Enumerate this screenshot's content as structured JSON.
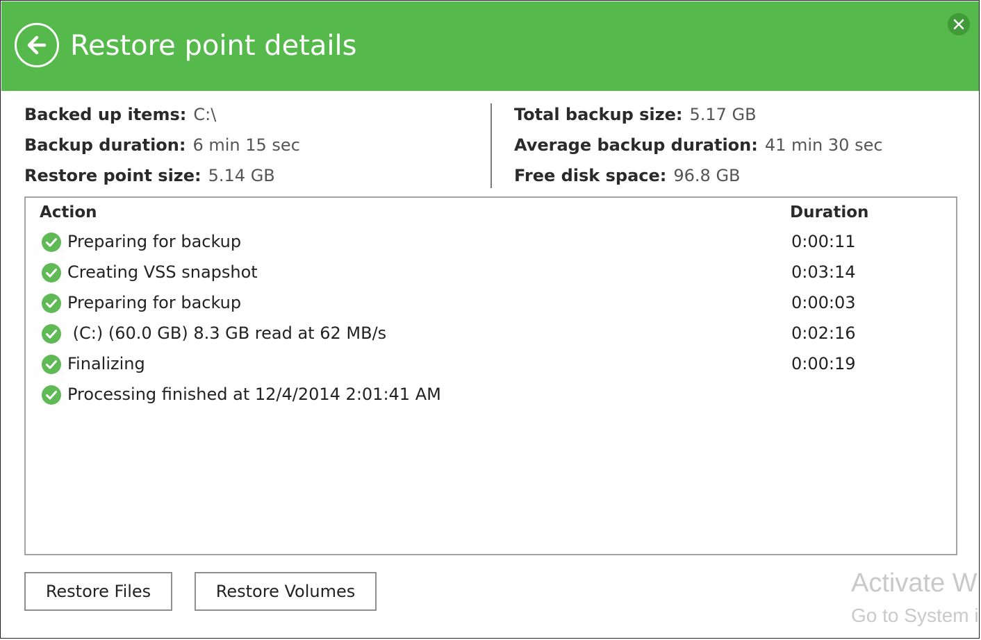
{
  "header": {
    "title": "Restore point details",
    "back_icon": "back-arrow-circle-icon",
    "close_icon": "close-icon",
    "accent_color": "#56b94b"
  },
  "summary": {
    "left": [
      {
        "key": "Backed up items:",
        "value": "C:\\"
      },
      {
        "key": "Backup duration:",
        "value": "6 min 15 sec"
      },
      {
        "key": "Restore point size:",
        "value": "5.14 GB"
      }
    ],
    "right": [
      {
        "key": "Total backup size:",
        "value": "5.17 GB"
      },
      {
        "key": "Average backup duration:",
        "value": "41 min 30 sec"
      },
      {
        "key": "Free disk space:",
        "value": "96.8 GB"
      }
    ]
  },
  "log": {
    "columns": {
      "action": "Action",
      "duration": "Duration"
    },
    "status_icon": "success-check-icon",
    "rows": [
      {
        "action": "Preparing for backup",
        "duration": "0:00:11"
      },
      {
        "action": "Creating VSS snapshot",
        "duration": "0:03:14"
      },
      {
        "action": "Preparing for backup",
        "duration": "0:00:03"
      },
      {
        "action": " (C:) (60.0 GB) 8.3 GB read at 62 MB/s",
        "duration": "0:02:16"
      },
      {
        "action": "Finalizing",
        "duration": "0:00:19"
      },
      {
        "action": "Processing finished at 12/4/2014 2:01:41 AM",
        "duration": ""
      }
    ]
  },
  "buttons": {
    "restore_files": "Restore Files",
    "restore_volumes": "Restore Volumes"
  },
  "watermark": {
    "line1": "Activate W",
    "line2": "Go to System i"
  }
}
